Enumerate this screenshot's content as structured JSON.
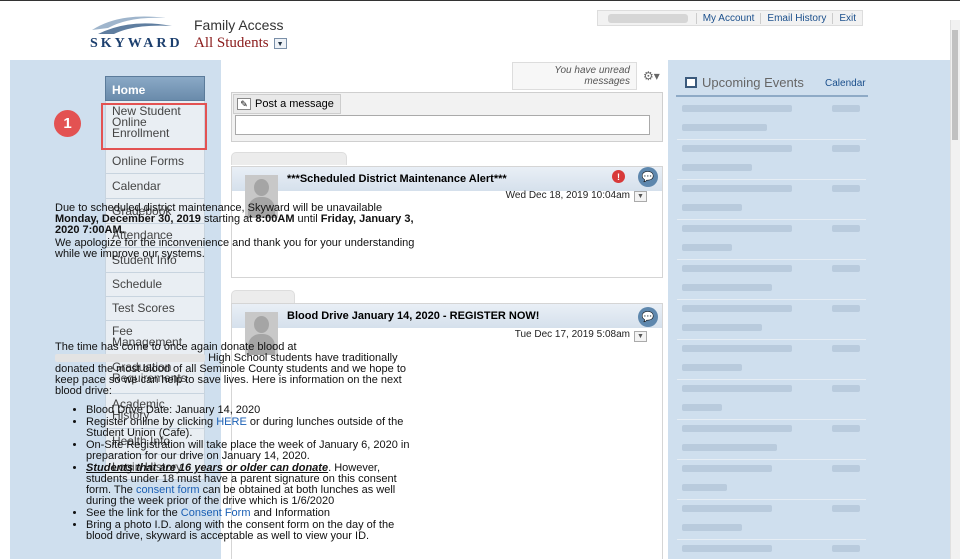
{
  "header": {
    "logo_text": "SKYWARD",
    "app_title": "Family Access",
    "student_selector": "All Students",
    "links": [
      "My Account",
      "Email History",
      "Exit"
    ]
  },
  "nav": {
    "home": "Home",
    "items": [
      "New Student Online Enrollment",
      "Online Forms",
      "Calendar",
      "Gradebook",
      "Attendance",
      "Student Info",
      "Schedule",
      "Test Scores",
      "Fee Management",
      "Graduation Requirements",
      "Academic History",
      "Health Info",
      "Login History"
    ]
  },
  "callout": {
    "step_number": "1"
  },
  "messages": {
    "unread_notice": "You have unread messages",
    "post_tab": "Post a message",
    "alert": {
      "title": "***Scheduled District Maintenance Alert***",
      "date": "Wed Dec 18, 2019 10:04am",
      "body_1": "Due to scheduled district maintenance, Skyward will be unavailable",
      "body_1_bold": "Monday, December 30, 2019",
      "body_1b": "starting at",
      "body_1c": "8:00AM",
      "body_1d": "until",
      "body_1e": "Friday, January 3, 2020 7:00AM.",
      "body_2": "We apologize for the inconvenience and thank you for your understanding while we improve our systems."
    },
    "blood": {
      "title": "Blood Drive January 14, 2020 - REGISTER NOW!",
      "date": "Tue Dec 17, 2019 5:08am",
      "intro_1": "The time has come to once again donate blood at",
      "intro_2": "High School students have traditionally donated the most blood of all Seminole County students and we hope to keep pace so we can help to save lives. Here is information on the next blood drive:",
      "bullet_1": "Blood Drive Date: January 14, 2020",
      "bullet_2a": "Register online by clicking",
      "bullet_2_link": "HERE",
      "bullet_2b": "or during lunches outside of the Student Union (Cafe).",
      "bullet_3": "On-Site Registration will take place the week of January 6, 2020 in preparation for our drive on January 14, 2020.",
      "bullet_4_emph": "Students that are 16 years or older can donate",
      "bullet_4a": ". However, students under 18 must have a parent signature on this consent form. The",
      "bullet_4_link": "consent form",
      "bullet_4b": "can be obtained at both lunches as well during the week prior of the drive which is 1/6/2020",
      "bullet_5a": "See the link for the",
      "bullet_5_link": "Consent Form",
      "bullet_5b": "and Information",
      "bullet_6": "Bring a photo I.D. along with the consent form on the day of the blood drive, skyward is acceptable as well to view your ID."
    }
  },
  "events": {
    "title": "Upcoming Events",
    "calendar_link": "Calendar"
  }
}
